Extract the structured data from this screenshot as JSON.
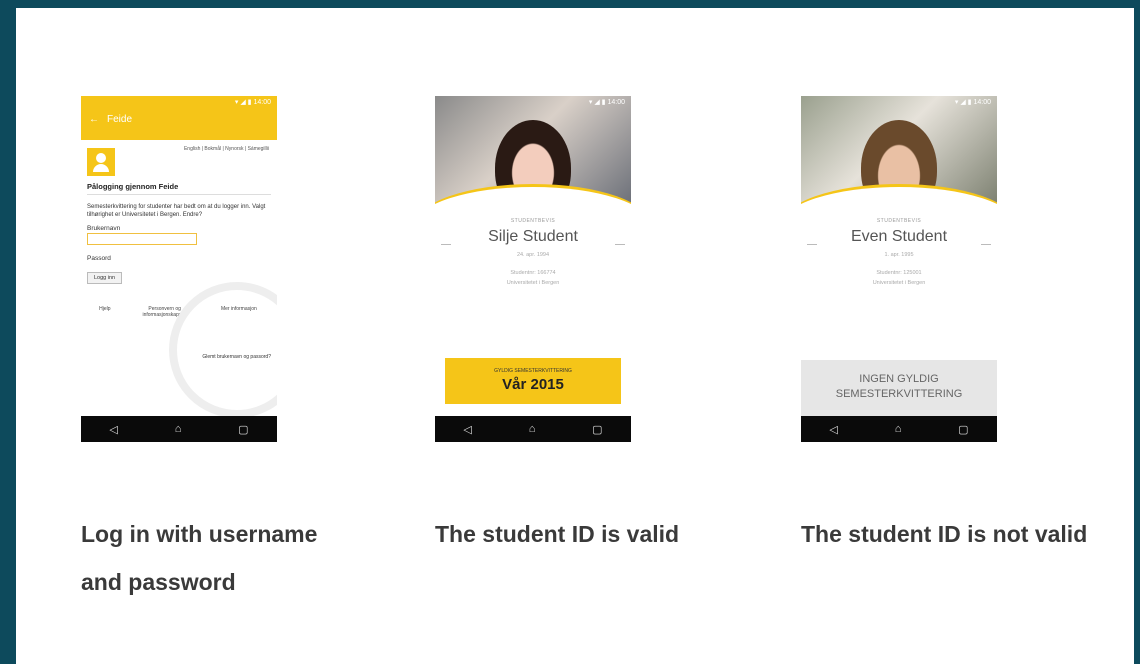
{
  "login": {
    "header_title": "Feide",
    "languages": "English | Bokmål | Nynorsk | Sámegillii",
    "section_title": "Pålogging gjennom Feide",
    "info_text": "Semesterkvittering for studenter har bedt om at du logger inn. Valgt tilhørighet er Universitetet i Bergen. Endre?",
    "username_label": "Brukernavn",
    "password_label": "Passord",
    "login_button": "Logg inn",
    "forgot_link": "Glemt brukernavn og passord?",
    "footer": [
      "Hjelp",
      "Personvern og informasjonskapsler",
      "Mer informasjon"
    ]
  },
  "card_valid": {
    "label": "STUDENTBEVIS",
    "name": "Silje Student",
    "birth": "24. apr. 1994",
    "student_no": "Studentnr: 166774",
    "institution": "Universitetet i Bergen",
    "box_title": "GYLDIG SEMESTERKVITTERING",
    "box_value": "Vår 2015"
  },
  "card_invalid": {
    "label": "STUDENTBEVIS",
    "name": "Even Student",
    "birth": "1. apr. 1995",
    "student_no": "Studentnr: 125001",
    "institution": "Universitetet i Bergen",
    "box_line1": "INGEN GYLDIG",
    "box_line2": "SEMESTERKVITTERING"
  },
  "captions": {
    "login": "Log in with username and password",
    "valid": "The student ID is valid",
    "invalid": "The student ID is not valid"
  },
  "colors": {
    "accent": "#f5c518",
    "frame": "#0d4a5c"
  }
}
